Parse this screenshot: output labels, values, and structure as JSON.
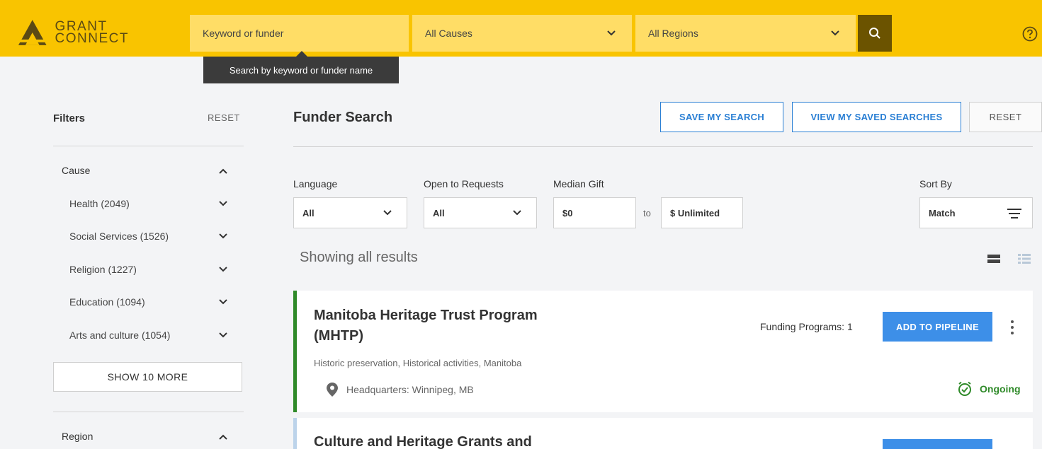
{
  "app": {
    "logo_line1": "GRANT",
    "logo_line2": "CONNECT"
  },
  "search": {
    "keyword_placeholder": "Keyword or funder",
    "cause_selected": "All Causes",
    "region_selected": "All Regions",
    "tooltip": "Search by keyword or funder name"
  },
  "sidebar": {
    "title": "Filters",
    "reset_label": "RESET",
    "cause": {
      "title": "Cause",
      "items": [
        {
          "label": "Health (2049)"
        },
        {
          "label": "Social Services (1526)"
        },
        {
          "label": "Religion (1227)"
        },
        {
          "label": "Education (1094)"
        },
        {
          "label": "Arts and culture (1054)"
        }
      ],
      "show_more": "SHOW 10 MORE"
    },
    "region": {
      "title": "Region"
    }
  },
  "main": {
    "title": "Funder Search",
    "save_search": "SAVE MY SEARCH",
    "view_saved": "VIEW MY SAVED SEARCHES",
    "reset": "RESET",
    "language": {
      "label": "Language",
      "value": "All"
    },
    "open_requests": {
      "label": "Open to Requests",
      "value": "All"
    },
    "median_gift": {
      "label": "Median Gift",
      "min": "$0",
      "to": "to",
      "max": "$ Unlimited"
    },
    "sort": {
      "label": "Sort By",
      "value": "Match"
    },
    "showing": "Showing all results"
  },
  "results": [
    {
      "title": "Manitoba Heritage Trust Program (MHTP)",
      "tags": "Historic preservation, Historical activities, Manitoba",
      "hq": "Headquarters: Winnipeg, MB",
      "programs": "Funding Programs: 1",
      "action": "ADD TO PIPELINE",
      "status": "Ongoing"
    },
    {
      "title": "Culture and Heritage Grants and"
    }
  ],
  "colors": {
    "brand": "#f9c400",
    "accent": "#3d8fe8",
    "success": "#2f8a29"
  },
  "icons": {
    "search": "search-icon",
    "help": "help-icon",
    "chevron": "chevron-down-icon",
    "sort": "sort-icon",
    "location": "location-pin-icon",
    "alarm": "alarm-clock-icon"
  }
}
